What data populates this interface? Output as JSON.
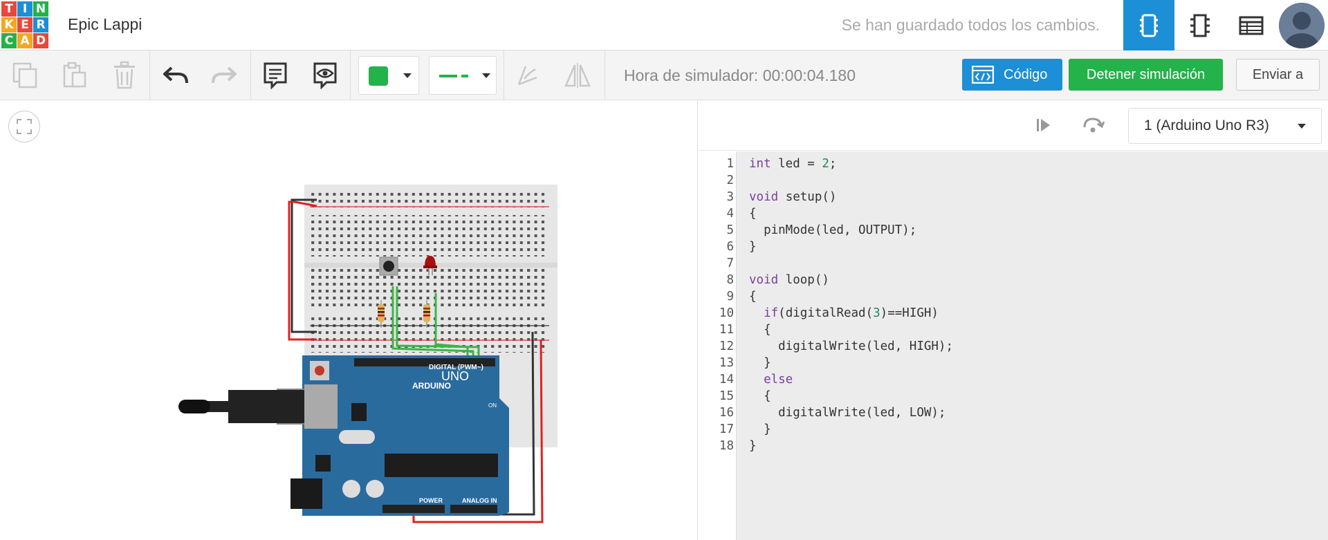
{
  "app": {
    "logo_letters": [
      "T",
      "I",
      "N",
      "K",
      "E",
      "R",
      "C",
      "A",
      "D"
    ],
    "logo_colors": [
      "#e8483b",
      "#1c8fd6",
      "#24b24b",
      "#f5a623",
      "#e8483b",
      "#1c8fd6",
      "#24b24b",
      "#f5a623",
      "#e8483b"
    ],
    "project_name": "Epic Lappi",
    "save_status": "Se han guardado todos los cambios."
  },
  "view_buttons": [
    {
      "name": "circuit-view",
      "icon": "breadboard-icon",
      "active": true
    },
    {
      "name": "schematic-view",
      "icon": "chip-icon",
      "active": false
    },
    {
      "name": "components-list-view",
      "icon": "list-icon",
      "active": false
    }
  ],
  "toolbar": {
    "sim_time": "Hora de simulador: 00:00:04.180",
    "code_label": "Código",
    "stop_label": "Detener simulación",
    "send_label": "Enviar a",
    "fill_color": "#24b24b",
    "wire_color": "#24b24b"
  },
  "code": {
    "board": "1 (Arduino Uno R3)",
    "lines": [
      "int led = 2;",
      "",
      "void setup()",
      "{",
      "  pinMode(led, OUTPUT);",
      "}",
      "",
      "void loop()",
      "{",
      "  if(digitalRead(3)==HIGH)",
      "  {",
      "    digitalWrite(led, HIGH);",
      "  }",
      "  else",
      "  {",
      "    digitalWrite(led, LOW);",
      "  }",
      "}"
    ]
  },
  "board": {
    "model_label": "ARDUINO",
    "uno_label": "UNO",
    "digital_label": "DIGITAL (PWM~)",
    "power_label": "POWER",
    "analog_label": "ANALOG IN",
    "on_label": "ON"
  }
}
